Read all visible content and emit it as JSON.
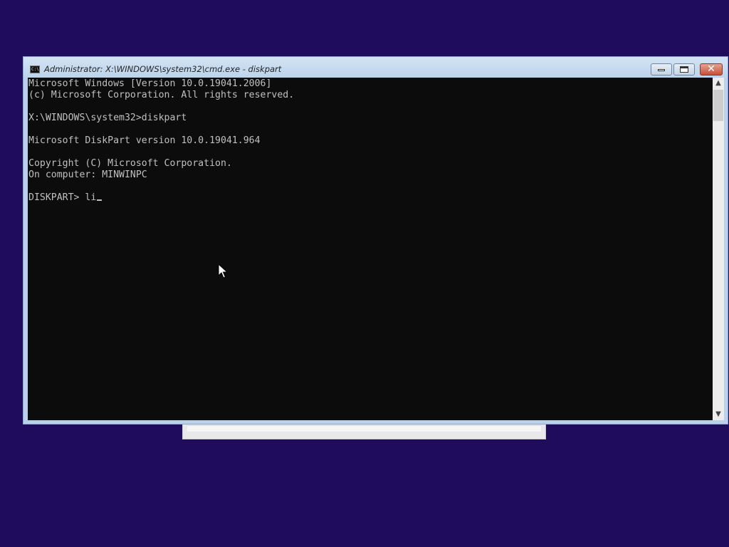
{
  "cmd_window": {
    "icon_label": "C:\\",
    "title": "Administrator: X:\\WINDOWS\\system32\\cmd.exe - diskpart",
    "controls": {
      "minimize_icon": "minimize-icon",
      "maximize_icon": "maximize-icon",
      "close_icon": "close-icon",
      "close_glyph": "✕"
    },
    "console_lines": [
      "Microsoft Windows [Version 10.0.19041.2006]",
      "(c) Microsoft Corporation. All rights reserved.",
      "",
      "X:\\WINDOWS\\system32>diskpart",
      "",
      "Microsoft DiskPart version 10.0.19041.964",
      "",
      "Copyright (C) Microsoft Corporation.",
      "On computer: MINWINPC",
      "",
      "DISKPART> li"
    ],
    "scrollbar": {
      "up_arrow": "▲",
      "down_arrow": "▼"
    }
  },
  "colors": {
    "desktop_background": "#200c5c",
    "console_background": "#0c0c0c",
    "console_text": "#c0c0c0",
    "close_button": "#c7503a"
  }
}
